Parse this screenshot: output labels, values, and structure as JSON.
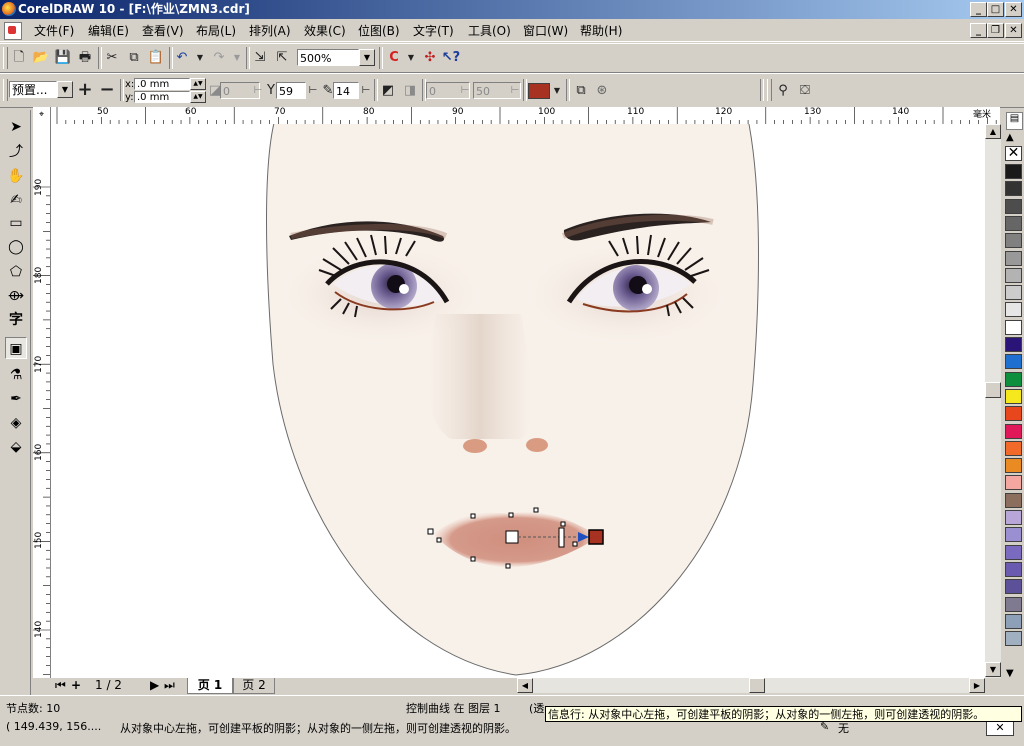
{
  "window": {
    "title": "CorelDRAW 10 - [F:\\作业\\ZMN3.cdr]"
  },
  "menubar": {
    "items": [
      "文件(F)",
      "编辑(E)",
      "查看(V)",
      "布局(L)",
      "排列(A)",
      "效果(C)",
      "位图(B)",
      "文字(T)",
      "工具(O)",
      "窗口(W)",
      "帮助(H)"
    ]
  },
  "standard_toolbar": {
    "zoom": "500%"
  },
  "property_bar": {
    "preset": "预置...",
    "offset_x": ".0 mm",
    "offset_y": ".0 mm",
    "opacity": "0",
    "opacity_disabled": "0",
    "shadow_opacity": "59",
    "feather": "14",
    "angle": "0",
    "stretch": "50",
    "x_label": "x:",
    "y_label": "y:",
    "shadow_color": "#a83222"
  },
  "rulers": {
    "h_labels": [
      "50",
      "60",
      "70",
      "80",
      "90",
      "100",
      "110",
      "120",
      "130",
      "140"
    ],
    "unit": "毫米",
    "v_labels": [
      "190",
      "180",
      "170",
      "160",
      "150",
      "140"
    ]
  },
  "page_nav": {
    "counter": "1 / 2",
    "page1": "页 1",
    "page2": "页 2"
  },
  "status": {
    "nodes": "节点数: 10",
    "object": "控制曲线  在  图层 1",
    "trans": "(透",
    "coords": "( 149.439, 156....",
    "hint": "从对象中心左拖，可创建平板的阴影；从对象的一侧左拖，则可创建透视的阴影。",
    "tooltip": "信息行: 从对象中心左拖，可创建平板的阴影；从对象的一侧左拖，则可创建透视的阴影。",
    "fill_none": "无"
  },
  "palette": {
    "colors": [
      "#1a1a1a",
      "#333333",
      "#4d4d4d",
      "#666666",
      "#808080",
      "#999999",
      "#b3b3b3",
      "#cccccc",
      "#e6e6e6",
      "#ffffff",
      "#2b1478",
      "#1f6fd1",
      "#0e8f3e",
      "#f5e81c",
      "#e8461d",
      "#e0185a",
      "#f26a2a",
      "#e98a23",
      "#f4a6a0",
      "#8c6e5e",
      "#b9a6d8",
      "#9a8fd0",
      "#7a6ac0",
      "#6a5ab0",
      "#5c5098",
      "#807a90",
      "#8da0b8",
      "#a0b0c0"
    ]
  }
}
